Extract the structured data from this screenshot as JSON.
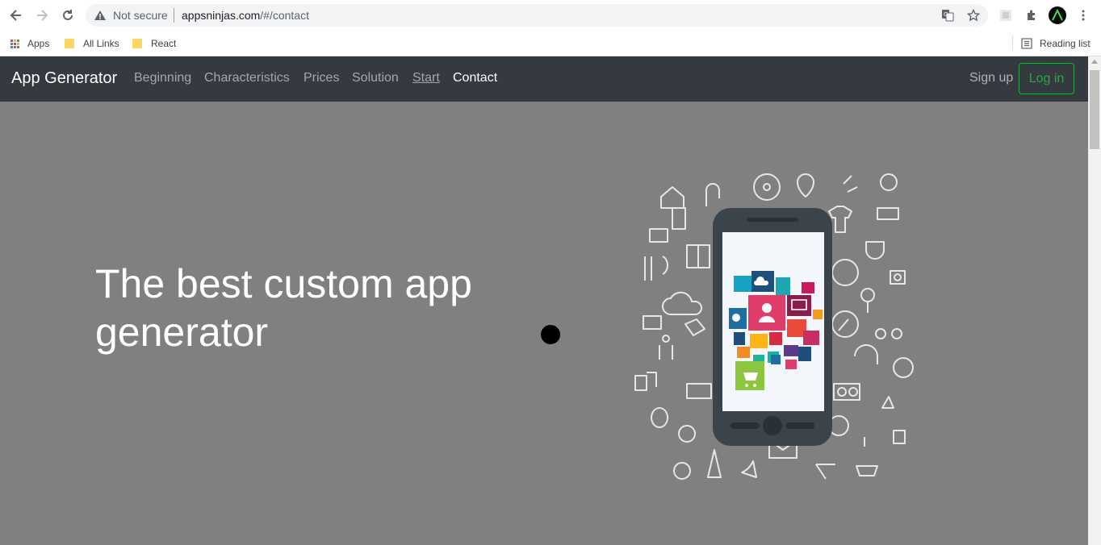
{
  "browser": {
    "security_label": "Not secure",
    "url_domain": "appsninjas.com",
    "url_path": "/#/contact",
    "bookmarks": [
      {
        "label": "Apps"
      },
      {
        "label": "All Links"
      },
      {
        "label": "React"
      }
    ],
    "reading_list": "Reading list"
  },
  "site": {
    "brand": "App Generator",
    "nav": [
      {
        "label": "Beginning"
      },
      {
        "label": "Characteristics"
      },
      {
        "label": "Prices"
      },
      {
        "label": "Solution"
      },
      {
        "label": "Start"
      },
      {
        "label": "Contact"
      }
    ],
    "signup": "Sign up",
    "login": "Log in",
    "hero_title": "The best custom app generator"
  },
  "colors": {
    "navbar_bg": "#343a40",
    "hero_bg": "#808080",
    "login_accent": "#28a745"
  }
}
